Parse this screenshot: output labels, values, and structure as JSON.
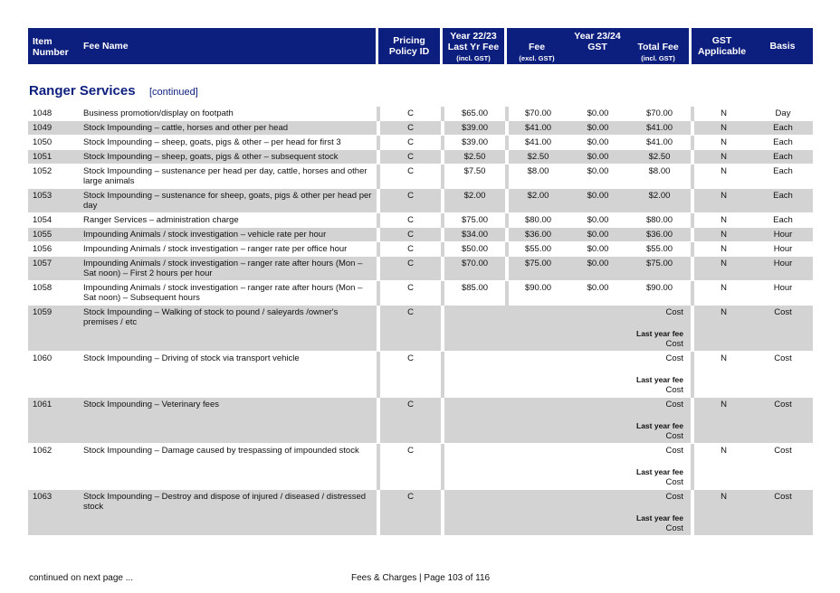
{
  "header": {
    "item_number": "Item Number",
    "fee_name": "Fee Name",
    "pricing": "Pricing Policy ID",
    "year_prev": "Year 22/23",
    "last_yr_fee": "Last Yr Fee",
    "incl_gst": "(incl. GST)",
    "year_cur": "Year 23/24",
    "fee": "Fee",
    "excl_gst": "(excl. GST)",
    "gst": "GST",
    "total_fee": "Total Fee",
    "total_incl": "(incl. GST)",
    "gst_applicable": "GST Applicable",
    "basis": "Basis"
  },
  "section": {
    "title": "Ranger Services",
    "continued": "[continued]"
  },
  "rows": [
    {
      "num": "1048",
      "name": "Business promotion/display on footpath",
      "policy": "C",
      "last": "$65.00",
      "fee": "$70.00",
      "gst": "$0.00",
      "total": "$70.00",
      "gsta": "N",
      "basis": "Day"
    },
    {
      "num": "1049",
      "name": "Stock Impounding – cattle, horses and other per head",
      "policy": "C",
      "last": "$39.00",
      "fee": "$41.00",
      "gst": "$0.00",
      "total": "$41.00",
      "gsta": "N",
      "basis": "Each"
    },
    {
      "num": "1050",
      "name": "Stock Impounding – sheep, goats, pigs & other – per head for first 3",
      "policy": "C",
      "last": "$39.00",
      "fee": "$41.00",
      "gst": "$0.00",
      "total": "$41.00",
      "gsta": "N",
      "basis": "Each"
    },
    {
      "num": "1051",
      "name": "Stock Impounding – sheep, goats, pigs & other – subsequent stock",
      "policy": "C",
      "last": "$2.50",
      "fee": "$2.50",
      "gst": "$0.00",
      "total": "$2.50",
      "gsta": "N",
      "basis": "Each"
    },
    {
      "num": "1052",
      "name": "Stock Impounding – sustenance per head per day, cattle, horses and other large animals",
      "policy": "C",
      "last": "$7.50",
      "fee": "$8.00",
      "gst": "$0.00",
      "total": "$8.00",
      "gsta": "N",
      "basis": "Each"
    },
    {
      "num": "1053",
      "name": "Stock Impounding – sustenance for sheep, goats, pigs & other per head per day",
      "policy": "C",
      "last": "$2.00",
      "fee": "$2.00",
      "gst": "$0.00",
      "total": "$2.00",
      "gsta": "N",
      "basis": "Each"
    },
    {
      "num": "1054",
      "name": "Ranger Services – administration charge",
      "policy": "C",
      "last": "$75.00",
      "fee": "$80.00",
      "gst": "$0.00",
      "total": "$80.00",
      "gsta": "N",
      "basis": "Each"
    },
    {
      "num": "1055",
      "name": "Impounding Animals / stock investigation – vehicle rate per hour",
      "policy": "C",
      "last": "$34.00",
      "fee": "$36.00",
      "gst": "$0.00",
      "total": "$36.00",
      "gsta": "N",
      "basis": "Hour"
    },
    {
      "num": "1056",
      "name": "Impounding Animals / stock investigation – ranger rate per office hour",
      "policy": "C",
      "last": "$50.00",
      "fee": "$55.00",
      "gst": "$0.00",
      "total": "$55.00",
      "gsta": "N",
      "basis": "Hour"
    },
    {
      "num": "1057",
      "name": "Impounding Animals / stock investigation – ranger rate after hours (Mon – Sat noon) – First 2 hours per hour",
      "policy": "C",
      "last": "$70.00",
      "fee": "$75.00",
      "gst": "$0.00",
      "total": "$75.00",
      "gsta": "N",
      "basis": "Hour"
    },
    {
      "num": "1058",
      "name": "Impounding Animals / stock investigation – ranger rate after hours (Mon – Sat noon) – Subsequent hours",
      "policy": "C",
      "last": "$85.00",
      "fee": "$90.00",
      "gst": "$0.00",
      "total": "$90.00",
      "gsta": "N",
      "basis": "Hour"
    }
  ],
  "cost_rows": [
    {
      "num": "1059",
      "name": "Stock Impounding – Walking of stock to pound / saleyards /owner's premises / etc",
      "policy": "C",
      "cost": "Cost",
      "lyf": "Last year fee",
      "lyf_cost": "Cost",
      "gsta": "N",
      "basis": "Cost"
    },
    {
      "num": "1060",
      "name": "Stock Impounding – Driving of stock via transport vehicle",
      "policy": "C",
      "cost": "Cost",
      "lyf": "Last year fee",
      "lyf_cost": "Cost",
      "gsta": "N",
      "basis": "Cost"
    },
    {
      "num": "1061",
      "name": "Stock Impounding – Veterinary fees",
      "policy": "C",
      "cost": "Cost",
      "lyf": "Last year fee",
      "lyf_cost": "Cost",
      "gsta": "N",
      "basis": "Cost"
    },
    {
      "num": "1062",
      "name": "Stock Impounding – Damage caused by trespassing of impounded stock",
      "policy": "C",
      "cost": "Cost",
      "lyf": "Last year fee",
      "lyf_cost": "Cost",
      "gsta": "N",
      "basis": "Cost"
    },
    {
      "num": "1063",
      "name": "Stock Impounding – Destroy and dispose of injured / diseased / distressed stock",
      "policy": "C",
      "cost": "Cost",
      "lyf": "Last year fee",
      "lyf_cost": "Cost",
      "gsta": "N",
      "basis": "Cost"
    }
  ],
  "footer": {
    "left": "continued on next page ...",
    "center": "Fees & Charges | Page 103 of 116"
  }
}
